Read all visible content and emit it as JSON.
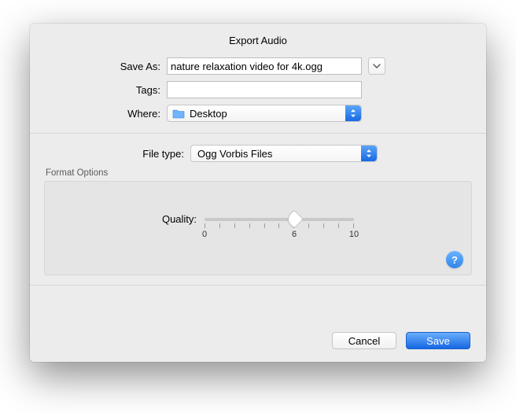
{
  "title": "Export Audio",
  "labels": {
    "save_as": "Save As:",
    "tags": "Tags:",
    "where": "Where:",
    "file_type": "File type:",
    "format_options": "Format Options",
    "quality": "Quality:"
  },
  "fields": {
    "save_as_value": "nature relaxation video for 4k.ogg",
    "tags_value": "",
    "where_value": "Desktop",
    "file_type_value": "Ogg Vorbis Files"
  },
  "slider": {
    "min": 0,
    "max": 10,
    "value": 6,
    "ticks_label_left": "0",
    "ticks_label_mid": "6",
    "ticks_label_right": "10"
  },
  "buttons": {
    "cancel": "Cancel",
    "save": "Save",
    "help": "?"
  }
}
